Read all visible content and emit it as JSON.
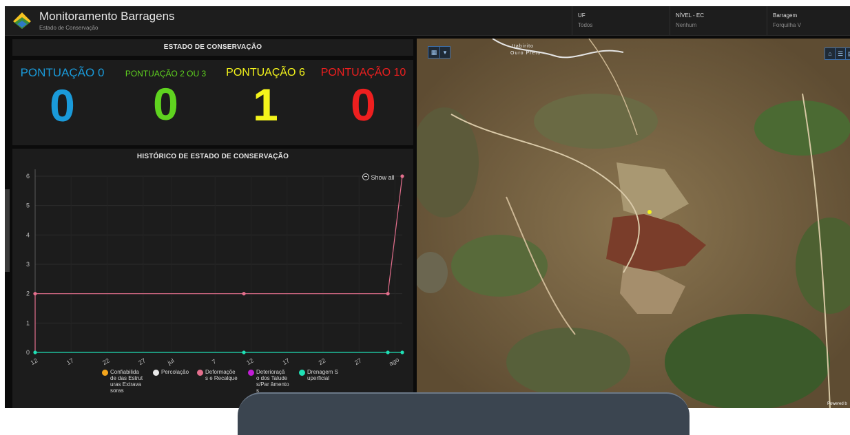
{
  "header": {
    "title": "Monitoramento Barragens",
    "subtitle": "Estado de Conservação",
    "filters": [
      {
        "label": "UF",
        "value": "Todos"
      },
      {
        "label": "NÍVEL - EC",
        "value": "Nenhum"
      },
      {
        "label": "Barragem",
        "value": "Forquilha V"
      }
    ]
  },
  "scores": {
    "title": "ESTADO DE CONSERVAÇÃO",
    "items": [
      {
        "label": "PONTUAÇÃO 0",
        "value": "0",
        "color": "#1a9ad9"
      },
      {
        "label": "PONTUAÇÃO 2 OU 3",
        "value": "0",
        "color": "#5fd31f"
      },
      {
        "label": "PONTUAÇÃO 6",
        "value": "1",
        "color": "#f3f31b"
      },
      {
        "label": "PONTUAÇÃO 10",
        "value": "0",
        "color": "#ee1f1f"
      }
    ]
  },
  "history": {
    "title": "HISTÓRICO DE ESTADO DE CONSERVAÇÃO",
    "show_all": "Show all"
  },
  "chart_data": {
    "type": "line",
    "title": "HISTÓRICO DE ESTADO DE CONSERVAÇÃO",
    "xlabel": "",
    "ylabel": "",
    "ylim": [
      0,
      6
    ],
    "yticks": [
      "0",
      "1",
      "2",
      "3",
      "4",
      "5",
      "6"
    ],
    "xticks": [
      "12",
      "17",
      "22",
      "27",
      "jul",
      "7",
      "12",
      "17",
      "22",
      "27",
      "ago"
    ],
    "xtick_positions": [
      12,
      17,
      22,
      27,
      31,
      37,
      42,
      47,
      52,
      57,
      62
    ],
    "xlim": [
      12,
      63
    ],
    "grid": true,
    "series": [
      {
        "name": "Confiabilidade das Estruturas Extravasoras",
        "color": "#f4a51c",
        "x": [],
        "y": []
      },
      {
        "name": "Percolação",
        "color": "#e9e9e9",
        "x": [],
        "y": []
      },
      {
        "name": "Deformações e Recalque",
        "color": "#e46f8d",
        "x": [
          12,
          41,
          61,
          63
        ],
        "y": [
          2,
          2,
          2,
          6
        ]
      },
      {
        "name": "Deterioração dos Taludes/Paramentos",
        "color": "#c21dd6",
        "x": [],
        "y": []
      },
      {
        "name": "Drenagem Superficial",
        "color": "#1fe0b5",
        "x": [
          12,
          41,
          61,
          63
        ],
        "y": [
          0,
          0,
          0,
          0
        ]
      }
    ]
  },
  "legend": [
    {
      "text": "Confiabilida de das Estruturas Extravasoras",
      "color": "#f4a51c"
    },
    {
      "text": "Percolação",
      "color": "#e9e9e9"
    },
    {
      "text": "Deformaçõe s e Recalque",
      "color": "#e46f8d"
    },
    {
      "text": "Deterioraçã o dos Taludes/Par âmentos",
      "color": "#c21dd6"
    },
    {
      "text": "Drenagem Superficial",
      "color": "#1fe0b5"
    }
  ],
  "map": {
    "place_label_1": "Itabirito",
    "place_label_2": "Ouro Preto",
    "home_icon": "home-icon",
    "list_icon": "list-icon",
    "layers_icon": "layers-icon",
    "attribution": "Powered b"
  }
}
